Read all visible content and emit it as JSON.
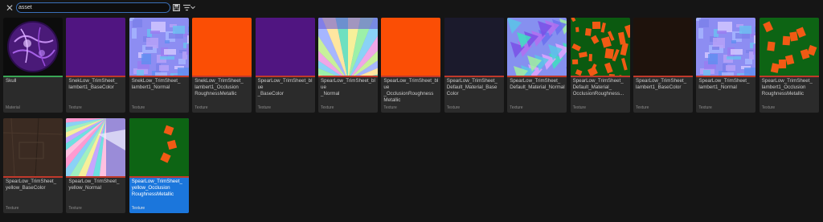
{
  "toolbar": {
    "search_value": "asset",
    "clear_icon": "close-icon",
    "save_icon": "save-search-icon",
    "filter_icon": "filter-icon",
    "chevron_icon": "chevron-down-icon"
  },
  "colors": {
    "texture_stripe": "#c0392b",
    "material_stripe": "#3aa655",
    "selected": "#1b76dc"
  },
  "assets": [
    {
      "name": "Skull",
      "type": "Material",
      "thumb": "skull"
    },
    {
      "name": "SnekLow_TrimSheet_\nlambert1_BaseColor",
      "type": "Texture",
      "thumb": "purple"
    },
    {
      "name": "SnekLow_TrimSheet_\nlambert1_Normal",
      "type": "Texture",
      "thumb": "normal-blue"
    },
    {
      "name": "SnekLow_TrimSheet_\nlambert1_Occlusion\nRoughnessMetallic",
      "type": "Texture",
      "thumb": "orange"
    },
    {
      "name": "SpearLow_TrimSheet_blue\n_BaseColor",
      "type": "Texture",
      "thumb": "purple"
    },
    {
      "name": "SpearLow_TrimSheet_blue\n_Normal",
      "type": "Texture",
      "thumb": "rays"
    },
    {
      "name": "SpearLow_TrimSheet_blue\n_OcclusionRoughness\nMetallic",
      "type": "Texture",
      "thumb": "orange"
    },
    {
      "name": "SpearLow_TrimSheet_\nDefault_Material_Base\nColor",
      "type": "Texture",
      "thumb": "dark-navy"
    },
    {
      "name": "SpearLow_TrimSheet_\nDefault_Material_Normal",
      "type": "Texture",
      "thumb": "normal-poly"
    },
    {
      "name": "SpearLow_TrimSheet_\nDefault_Material_\nOcclusionRoughness...",
      "type": "Texture",
      "thumb": "green-orange-dense"
    },
    {
      "name": "SpearLow_TrimSheet_\nlambert1_BaseColor",
      "type": "Texture",
      "thumb": "dark-brown"
    },
    {
      "name": "SpearLow_TrimSheet_\nlambert1_Normal",
      "type": "Texture",
      "thumb": "normal-blue"
    },
    {
      "name": "SpearLow_TrimSheet_\nlambert1_Occlusion\nRoughnessMetallic",
      "type": "Texture",
      "thumb": "green-orange"
    },
    {
      "name": "SpearLow_TrimSheet_\nyellow_BaseColor",
      "type": "Texture",
      "thumb": "brown"
    },
    {
      "name": "SpearLow_TrimSheet_\nyellow_Normal",
      "type": "Texture",
      "thumb": "rays2"
    },
    {
      "name": "SpearLow_TrimSheet_\nyellow_Occlusion\nRoughnessMetallic",
      "type": "Texture",
      "thumb": "green-few",
      "selected": true
    }
  ]
}
